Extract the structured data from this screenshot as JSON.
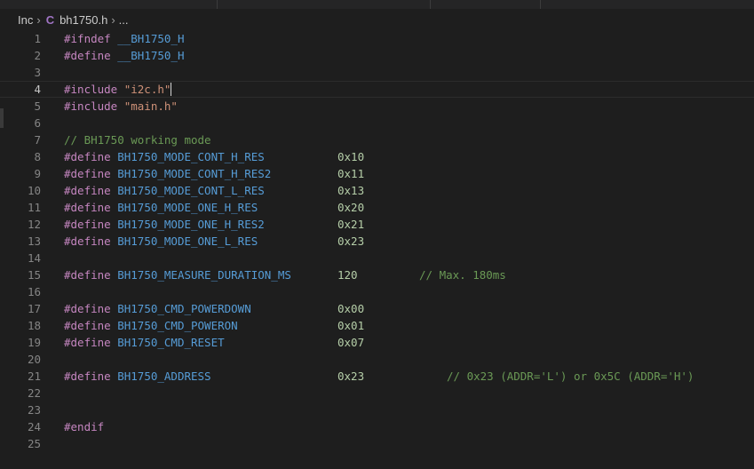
{
  "breadcrumb": {
    "folder": "Inc",
    "file_icon": "c-file-icon",
    "file_icon_glyph": "C",
    "file": "bh1750.h",
    "symbol": "..."
  },
  "editor": {
    "lines": [
      {
        "n": "1",
        "tokens": [
          {
            "t": "#ifndef ",
            "c": "kw"
          },
          {
            "t": "__BH1750_H",
            "c": "mac"
          }
        ]
      },
      {
        "n": "2",
        "tokens": [
          {
            "t": "#define ",
            "c": "kw"
          },
          {
            "t": "__BH1750_H",
            "c": "mac"
          }
        ]
      },
      {
        "n": "3",
        "tokens": []
      },
      {
        "n": "4",
        "tokens": [
          {
            "t": "#include ",
            "c": "kw"
          },
          {
            "t": "\"i2c.h\"",
            "c": "str"
          }
        ],
        "current": true
      },
      {
        "n": "5",
        "tokens": [
          {
            "t": "#include ",
            "c": "kw"
          },
          {
            "t": "\"main.h\"",
            "c": "str"
          }
        ]
      },
      {
        "n": "6",
        "tokens": []
      },
      {
        "n": "7",
        "tokens": [
          {
            "t": "// BH1750 working mode",
            "c": "cmt"
          }
        ]
      },
      {
        "n": "8",
        "tokens": [
          {
            "t": "#define ",
            "c": "kw"
          },
          {
            "t": "BH1750_MODE_CONT_H_RES",
            "c": "mac"
          },
          {
            "t": "0x10",
            "c": "num",
            "col": 308
          }
        ]
      },
      {
        "n": "9",
        "tokens": [
          {
            "t": "#define ",
            "c": "kw"
          },
          {
            "t": "BH1750_MODE_CONT_H_RES2",
            "c": "mac"
          },
          {
            "t": "0x11",
            "c": "num",
            "col": 308
          }
        ]
      },
      {
        "n": "10",
        "tokens": [
          {
            "t": "#define ",
            "c": "kw"
          },
          {
            "t": "BH1750_MODE_CONT_L_RES",
            "c": "mac"
          },
          {
            "t": "0x13",
            "c": "num",
            "col": 308
          }
        ]
      },
      {
        "n": "11",
        "tokens": [
          {
            "t": "#define ",
            "c": "kw"
          },
          {
            "t": "BH1750_MODE_ONE_H_RES",
            "c": "mac"
          },
          {
            "t": "0x20",
            "c": "num",
            "col": 308
          }
        ]
      },
      {
        "n": "12",
        "tokens": [
          {
            "t": "#define ",
            "c": "kw"
          },
          {
            "t": "BH1750_MODE_ONE_H_RES2",
            "c": "mac"
          },
          {
            "t": "0x21",
            "c": "num",
            "col": 308
          }
        ]
      },
      {
        "n": "13",
        "tokens": [
          {
            "t": "#define ",
            "c": "kw"
          },
          {
            "t": "BH1750_MODE_ONE_L_RES",
            "c": "mac"
          },
          {
            "t": "0x23",
            "c": "num",
            "col": 308
          }
        ]
      },
      {
        "n": "14",
        "tokens": []
      },
      {
        "n": "15",
        "tokens": [
          {
            "t": "#define ",
            "c": "kw"
          },
          {
            "t": "BH1750_MEASURE_DURATION_MS",
            "c": "mac"
          },
          {
            "t": "120",
            "c": "num",
            "col": 308
          },
          {
            "t": "// Max. 180ms",
            "c": "cmt",
            "col": 400
          }
        ]
      },
      {
        "n": "16",
        "tokens": []
      },
      {
        "n": "17",
        "tokens": [
          {
            "t": "#define ",
            "c": "kw"
          },
          {
            "t": "BH1750_CMD_POWERDOWN",
            "c": "mac"
          },
          {
            "t": "0x00",
            "c": "num",
            "col": 308
          }
        ]
      },
      {
        "n": "18",
        "tokens": [
          {
            "t": "#define ",
            "c": "kw"
          },
          {
            "t": "BH1750_CMD_POWERON",
            "c": "mac"
          },
          {
            "t": "0x01",
            "c": "num",
            "col": 308
          }
        ]
      },
      {
        "n": "19",
        "tokens": [
          {
            "t": "#define ",
            "c": "kw"
          },
          {
            "t": "BH1750_CMD_RESET",
            "c": "mac"
          },
          {
            "t": "0x07",
            "c": "num",
            "col": 308
          }
        ]
      },
      {
        "n": "20",
        "tokens": []
      },
      {
        "n": "21",
        "tokens": [
          {
            "t": "#define ",
            "c": "kw"
          },
          {
            "t": "BH1750_ADDRESS",
            "c": "mac"
          },
          {
            "t": "0x23",
            "c": "num",
            "col": 308
          },
          {
            "t": "// 0x23 (ADDR='L') or 0x5C (ADDR='H')",
            "c": "cmt",
            "col": 431
          }
        ]
      },
      {
        "n": "22",
        "tokens": []
      },
      {
        "n": "23",
        "tokens": []
      },
      {
        "n": "24",
        "tokens": [
          {
            "t": "#endif",
            "c": "kw"
          }
        ]
      },
      {
        "n": "25",
        "tokens": []
      }
    ]
  },
  "colors": {
    "background": "#1e1e1e",
    "keyword": "#c586c0",
    "macro": "#569cd6",
    "string": "#ce9178",
    "number": "#b5cea8",
    "comment": "#6a9955",
    "line_number": "#858585",
    "c_icon": "#a074c4"
  }
}
